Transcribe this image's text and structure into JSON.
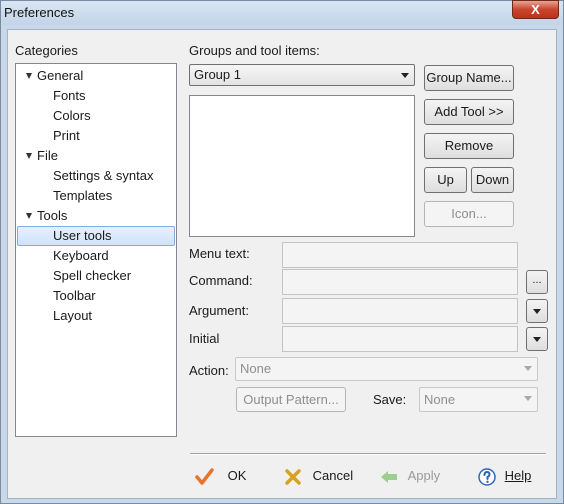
{
  "window": {
    "title": "Preferences",
    "close_glyph": "X"
  },
  "categories": {
    "label": "Categories",
    "items": [
      {
        "label": "General",
        "expanded": true
      },
      {
        "label": "Fonts"
      },
      {
        "label": "Colors"
      },
      {
        "label": "Print"
      },
      {
        "label": "File",
        "expanded": true
      },
      {
        "label": "Settings & syntax"
      },
      {
        "label": "Templates"
      },
      {
        "label": "Tools",
        "expanded": true
      },
      {
        "label": "User tools",
        "selected": true
      },
      {
        "label": "Keyboard"
      },
      {
        "label": "Spell checker"
      },
      {
        "label": "Toolbar"
      },
      {
        "label": "Layout"
      }
    ]
  },
  "groups": {
    "label": "Groups and tool items:",
    "selected_group": "Group 1",
    "buttons": {
      "group_name": "Group Name...",
      "add_tool": "Add Tool >>",
      "remove": "Remove",
      "up": "Up",
      "down": "Down",
      "icon": "Icon..."
    }
  },
  "fields": {
    "menu_text": {
      "label": "Menu text:",
      "value": ""
    },
    "command": {
      "label": "Command:",
      "value": "",
      "browse": "..."
    },
    "argument": {
      "label": "Argument:",
      "value": ""
    },
    "initial": {
      "label": "Initial",
      "value": ""
    },
    "action": {
      "label": "Action:",
      "value": "None"
    },
    "output_pattern": "Output Pattern...",
    "save": {
      "label": "Save:",
      "value": "None"
    }
  },
  "footer": {
    "ok": "OK",
    "cancel": "Cancel",
    "apply": "Apply",
    "help": "Help"
  },
  "colors": {
    "ok_check": "#e8742a",
    "cancel_x": "#d9a21b",
    "apply_arrow": "#9ccf8e",
    "help_icon": "#2f64b8"
  }
}
